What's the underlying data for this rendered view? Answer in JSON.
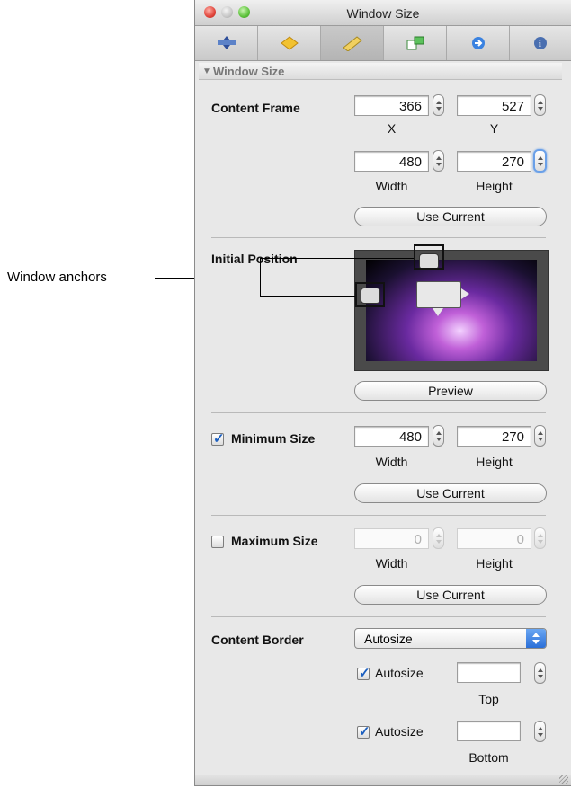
{
  "callout": {
    "label": "Window anchors"
  },
  "window": {
    "title": "Window Size"
  },
  "toolbar": {
    "tabs": [
      {
        "icon": "attributes-icon"
      },
      {
        "icon": "effects-icon"
      },
      {
        "icon": "size-ruler-icon",
        "selected": true
      },
      {
        "icon": "bindings-icon"
      },
      {
        "icon": "connections-icon"
      },
      {
        "icon": "identity-icon"
      }
    ]
  },
  "section": {
    "header": "Window Size"
  },
  "content_frame": {
    "label": "Content Frame",
    "x": "366",
    "x_label": "X",
    "y": "527",
    "y_label": "Y",
    "width": "480",
    "width_label": "Width",
    "height": "270",
    "height_label": "Height",
    "button": "Use Current"
  },
  "initial_position": {
    "label": "Initial Position",
    "button": "Preview"
  },
  "minimum_size": {
    "label": "Minimum Size",
    "checked": true,
    "width": "480",
    "width_label": "Width",
    "height": "270",
    "height_label": "Height",
    "button": "Use Current"
  },
  "maximum_size": {
    "label": "Maximum Size",
    "checked": false,
    "width": "0",
    "width_label": "Width",
    "height": "0",
    "height_label": "Height",
    "button": "Use Current"
  },
  "content_border": {
    "label": "Content Border",
    "popup_value": "Autosize",
    "top_checkbox": "Autosize",
    "top_value": "",
    "top_label": "Top",
    "bottom_checkbox": "Autosize",
    "bottom_value": "",
    "bottom_label": "Bottom"
  },
  "colors": {
    "accent": "#2a6fd8",
    "check": "#1c5fbf"
  }
}
